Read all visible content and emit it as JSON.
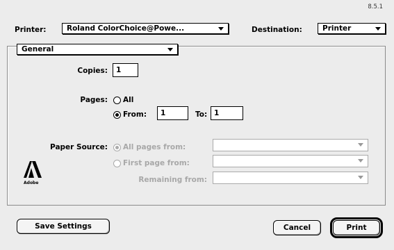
{
  "dialog": {
    "version": "8.5.1"
  },
  "printer": {
    "label": "Printer:",
    "value": "Roland ColorChoice@Powe..."
  },
  "destination": {
    "label": "Destination:",
    "value": "Printer"
  },
  "section": {
    "value": "General"
  },
  "copies": {
    "label": "Copies:",
    "value": "1"
  },
  "pages": {
    "label": "Pages:",
    "all_label": "All",
    "from_label": "From:",
    "from_value": "1",
    "to_label": "To:",
    "to_value": "1"
  },
  "paper_source": {
    "label": "Paper Source:",
    "all_pages_label": "All pages from:",
    "first_page_label": "First page from:",
    "remaining_label": "Remaining from:"
  },
  "logo": {
    "text": "Adobe"
  },
  "buttons": {
    "save": "Save Settings",
    "cancel": "Cancel",
    "print": "Print"
  },
  "colors": {
    "background": "#ececec",
    "disabled": "#a8a8a8"
  }
}
